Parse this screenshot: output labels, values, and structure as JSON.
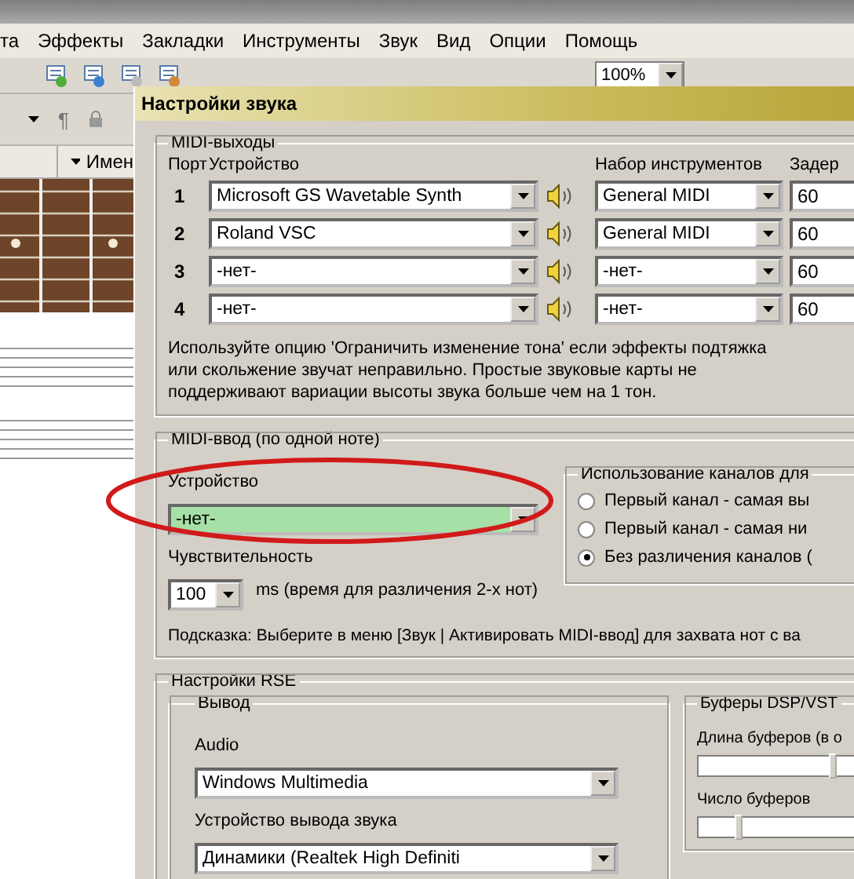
{
  "menu": [
    "та",
    "Эффекты",
    "Закладки",
    "Инструменты",
    "Звук",
    "Вид",
    "Опции",
    "Помощь"
  ],
  "toolbar": {
    "zoom": "100%"
  },
  "toolbar2": {
    "glyph": "¶"
  },
  "track_header": "Имен",
  "dialog": {
    "title": "Настройки звука",
    "midi_out": {
      "title": "MIDI-выходы",
      "columns": [
        "Порт",
        "Устройство",
        "Набор инструментов",
        "Задер"
      ],
      "rows": [
        {
          "port": "1",
          "device": "Microsoft GS Wavetable Synth",
          "bank": "General MIDI",
          "delay": "60"
        },
        {
          "port": "2",
          "device": "Roland VSC",
          "bank": "General MIDI",
          "delay": "60"
        },
        {
          "port": "3",
          "device": "-нет-",
          "bank": "-нет-",
          "delay": "60"
        },
        {
          "port": "4",
          "device": "-нет-",
          "bank": "-нет-",
          "delay": "60"
        }
      ],
      "note": "Используйте опцию 'Ограничить изменение тона' если эффекты подтяжка или скольжение звучат неправильно. Простые звуковые карты не поддерживают вариации высоты звука больше чем на 1 тон."
    },
    "midi_in": {
      "title": "MIDI-ввод (по одной ноте)",
      "device_label": "Устройство",
      "device": "-нет-",
      "sensitivity_label": "Чувствительность",
      "sensitivity": "100",
      "sensitivity_unit": "ms  (время для различения 2-х нот)",
      "channels": {
        "title": "Использование каналов для",
        "options": [
          {
            "label": "Первый канал - самая вы",
            "selected": false
          },
          {
            "label": "Первый канал - самая ни",
            "selected": false
          },
          {
            "label": "Без различения каналов (",
            "selected": true
          }
        ]
      },
      "hint": "Подсказка: Выберите в меню [Звук | Активировать MIDI-ввод] для захвата нот с ва"
    },
    "rse": {
      "title": "Настройки RSE",
      "output": {
        "title": "Вывод",
        "audio_label": "Audio",
        "audio": "Windows Multimedia",
        "device_label": "Устройство вывода звука",
        "device": "Динамики (Realtek High Definiti"
      },
      "buffers": {
        "title": "Буферы DSP/VST",
        "sliders": [
          {
            "label": "Длина буферов (в о",
            "level": 0.73
          },
          {
            "label": "Число буферов",
            "level": 0.2
          }
        ]
      }
    }
  }
}
